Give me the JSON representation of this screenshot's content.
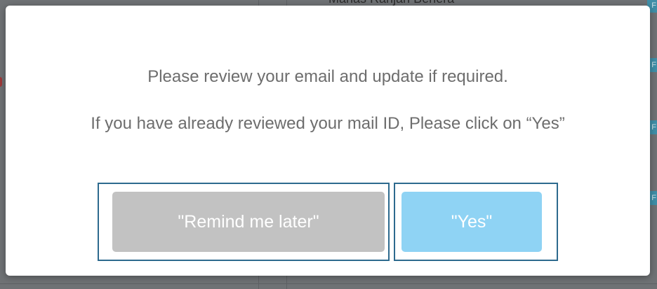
{
  "background": {
    "person_name": "Manas Ranjan Behera",
    "badge_letters": [
      "F",
      "F",
      "F",
      "F"
    ]
  },
  "dialog": {
    "message_primary": "Please review your email and update if required.",
    "message_secondary": "If you have already reviewed your mail ID, Please click on “Yes”",
    "remind_button_label": "\"Remind me later\"",
    "yes_button_label": "\"Yes\""
  },
  "colors": {
    "remind_button": "#c2c2c2",
    "yes_button": "#8fd3f4",
    "highlight_frame": "#2d6a8e",
    "message_text": "#6d6d6d"
  }
}
